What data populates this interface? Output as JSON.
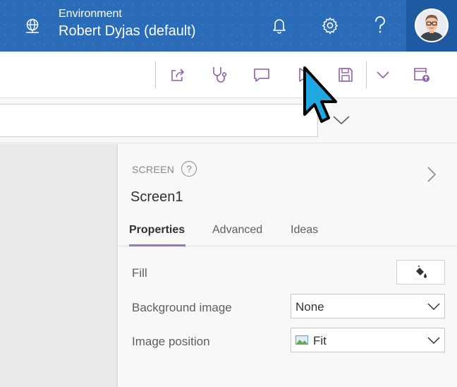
{
  "header": {
    "environment_label": "Environment",
    "environment_name": "Robert Dyjas (default)",
    "icons": [
      "globe-icon",
      "bell-icon",
      "gear-icon",
      "help-icon"
    ],
    "avatar": "avatar",
    "bg_color": "#2b6cb8"
  },
  "toolbar": {
    "icons": [
      "share-icon",
      "stethoscope-icon",
      "comment-icon",
      "play-icon",
      "save-icon",
      "chevron-down-icon",
      "publish-icon"
    ],
    "icon_color": "#8f5fa8"
  },
  "pane": {
    "type_label": "SCREEN",
    "help_glyph": "?",
    "screen_name": "Screen1",
    "tabs": [
      {
        "label": "Properties",
        "active": true
      },
      {
        "label": "Advanced",
        "active": false
      },
      {
        "label": "Ideas",
        "active": false
      }
    ],
    "properties": {
      "fill_label": "Fill",
      "background_image_label": "Background image",
      "background_image_value": "None",
      "image_position_label": "Image position",
      "image_position_value": "Fit"
    }
  }
}
